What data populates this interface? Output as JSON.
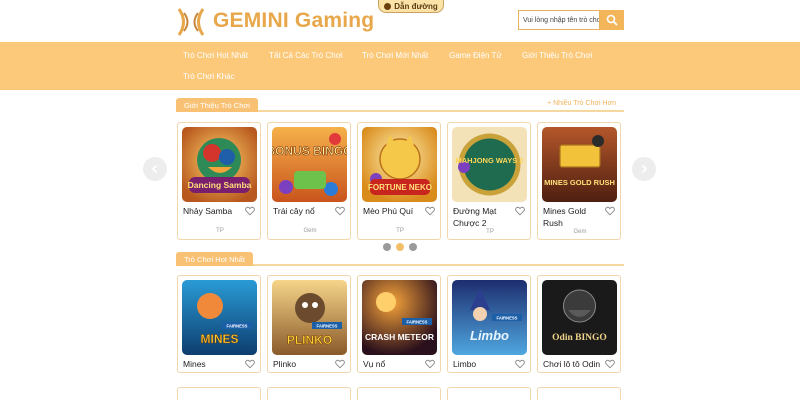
{
  "header": {
    "logo_text": "GEMINI Gaming",
    "guide_button": "Dẫn đường",
    "search_placeholder": "Vui lòng nhập tên trò chơi",
    "colors": {
      "accent": "#f3b55a",
      "nav_bg": "#fcc97a",
      "logo": "#e8a74a"
    }
  },
  "nav": {
    "items": [
      {
        "label": "Trò Chơi Hot Nhất"
      },
      {
        "label": "Tất Cả Các Trò Chơi"
      },
      {
        "label": "Trò Chơi Mới Nhất"
      },
      {
        "label": "Game Điện Tử"
      },
      {
        "label": "Giới Thiệu Trò Chơi"
      },
      {
        "label": "Trò Chơi Khác"
      }
    ]
  },
  "intro_section": {
    "title": "Giới Thiệu Trò Chơi",
    "more_link": "+ Nhiều Trò Chơi Hơn",
    "cards": [
      {
        "name": "Nhảy Samba",
        "provider": "TP",
        "art_title": "Dancing Samba"
      },
      {
        "name": "Trái cây nổ",
        "provider": "Gem",
        "art_title": "BONUS BINGO"
      },
      {
        "name": "Mèo Phú Quí",
        "provider": "TP",
        "art_title": "FORTUNE NEKO"
      },
      {
        "name": "Đường Mạt Chược 2",
        "provider": "TP",
        "art_title": "MAHJONG WAYS 2"
      },
      {
        "name": "Mines Gold Rush",
        "provider": "Gem",
        "art_title": "MINES GOLD RUSH"
      }
    ],
    "carousel": {
      "pages": 3,
      "active_page": 2
    }
  },
  "hot_section": {
    "title": "Trò Chơi Hot Nhất",
    "cards": [
      {
        "name": "Mines",
        "art_title": "MINES"
      },
      {
        "name": "Plinko",
        "art_title": "PLINKO"
      },
      {
        "name": "Vụ nổ",
        "art_title": "CRASH METEOR"
      },
      {
        "name": "Limbo",
        "art_title": "Limbo"
      },
      {
        "name": "Chơi lô tô Odin",
        "art_title": "Odin BINGO"
      }
    ],
    "badge": "FAIRNESS"
  },
  "icons": [
    "logo-mark-icon",
    "location-pin-icon",
    "search-icon",
    "heart-icon",
    "chevron-left-icon",
    "chevron-right-icon"
  ]
}
